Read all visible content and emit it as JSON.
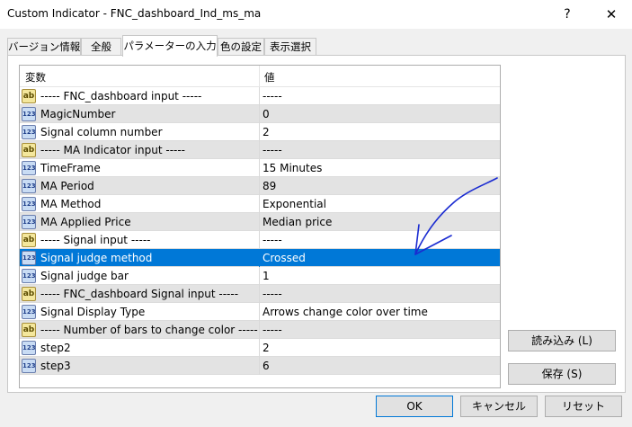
{
  "window": {
    "title": "Custom Indicator - FNC_dashboard_Ind_ms_ma",
    "help_label": "?",
    "close_label": "✕"
  },
  "tabs": [
    {
      "label": "バージョン情報"
    },
    {
      "label": "全般"
    },
    {
      "label": "パラメーターの入力"
    },
    {
      "label": "色の設定"
    },
    {
      "label": "表示選択"
    }
  ],
  "table": {
    "headers": {
      "variable": "変数",
      "value": "値"
    },
    "rows": [
      {
        "icon": "ab",
        "name": "----- FNC_dashboard input -----",
        "value": "-----"
      },
      {
        "icon": "123",
        "name": "MagicNumber",
        "value": "0"
      },
      {
        "icon": "123",
        "name": "Signal column number",
        "value": "2"
      },
      {
        "icon": "ab",
        "name": "----- MA Indicator input -----",
        "value": "-----"
      },
      {
        "icon": "123",
        "name": "TimeFrame",
        "value": "15 Minutes"
      },
      {
        "icon": "123",
        "name": "MA Period",
        "value": "89"
      },
      {
        "icon": "123",
        "name": "MA Method",
        "value": "Exponential"
      },
      {
        "icon": "123",
        "name": "MA Applied Price",
        "value": "Median price"
      },
      {
        "icon": "ab",
        "name": "----- Signal input -----",
        "value": "-----"
      },
      {
        "icon": "123",
        "name": "Signal judge method",
        "value": "Crossed"
      },
      {
        "icon": "123",
        "name": "Signal judge bar",
        "value": "1"
      },
      {
        "icon": "ab",
        "name": "----- FNC_dashboard Signal input -----",
        "value": "-----"
      },
      {
        "icon": "123",
        "name": "Signal Display Type",
        "value": "Arrows change color over time"
      },
      {
        "icon": "ab",
        "name": "----- Number of bars to change color -----",
        "value": "-----"
      },
      {
        "icon": "123",
        "name": "step2",
        "value": "2"
      },
      {
        "icon": "123",
        "name": "step3",
        "value": "6"
      }
    ]
  },
  "side_buttons": {
    "load": "読み込み (L)",
    "save": "保存 (S)"
  },
  "footer_buttons": {
    "ok": "OK",
    "cancel": "キャンセル",
    "reset": "リセット"
  },
  "colors": {
    "selection": "#0078d7",
    "annotation": "#1a2bd1",
    "row_shade": "#e3e3e3"
  }
}
